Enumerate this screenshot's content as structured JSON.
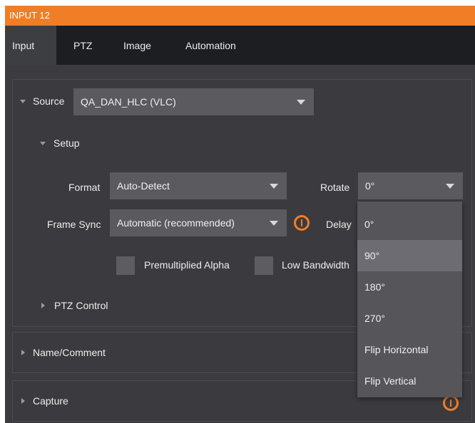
{
  "window": {
    "title": "INPUT 12"
  },
  "tabs": [
    {
      "label": "Input",
      "active": true
    },
    {
      "label": "PTZ"
    },
    {
      "label": "Image"
    },
    {
      "label": "Automation"
    }
  ],
  "source": {
    "label": "Source",
    "value": "QA_DAN_HLC (VLC)"
  },
  "setup": {
    "label": "Setup",
    "format": {
      "label": "Format",
      "value": "Auto-Detect"
    },
    "rotate": {
      "label": "Rotate",
      "value": "0°"
    },
    "frame_sync": {
      "label": "Frame Sync",
      "value": "Automatic (recommended)"
    },
    "delay": {
      "label": "Delay"
    },
    "premultiplied_alpha": {
      "label": "Premultiplied Alpha",
      "checked": false
    },
    "low_bandwidth": {
      "label": "Low Bandwidth",
      "checked": false
    },
    "ptz_control": {
      "label": "PTZ Control"
    }
  },
  "sections": {
    "name_comment": "Name/Comment",
    "capture": "Capture"
  },
  "rotate_menu": {
    "items": [
      {
        "label": "0°"
      },
      {
        "label": "90°",
        "highlighted": true
      },
      {
        "label": "180°"
      },
      {
        "label": "270°"
      },
      {
        "label": "Flip Horizontal"
      },
      {
        "label": "Flip Vertical"
      }
    ]
  },
  "colors": {
    "accent": "#f07e26",
    "tab_bar": "#1d1e21",
    "panel": "#3b3b3f",
    "control": "#5a5a5f"
  },
  "icons": [
    "chevron-down-icon",
    "chevron-right-icon",
    "caret-down-icon",
    "info-icon"
  ]
}
